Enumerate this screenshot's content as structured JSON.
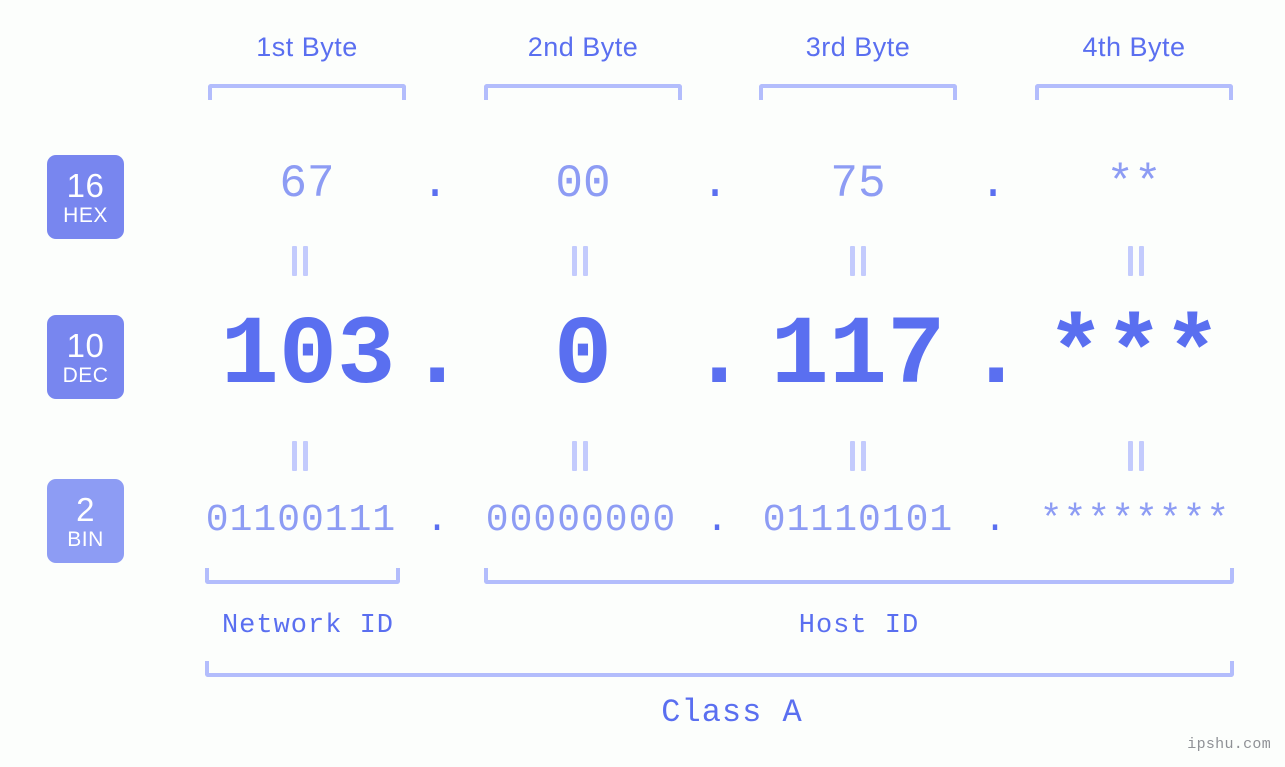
{
  "background_color": "#fcfefc",
  "accent_color": "#5a6ff0",
  "accent_light": "#8d9cf4",
  "bracket_color": "#b3bdfc",
  "byte_headers": [
    {
      "label": "1st Byte"
    },
    {
      "label": "2nd Byte"
    },
    {
      "label": "3rd Byte"
    },
    {
      "label": "4th Byte"
    }
  ],
  "bases": [
    {
      "number": "16",
      "name": "HEX",
      "badge_color": "#7886ef"
    },
    {
      "number": "10",
      "name": "DEC",
      "badge_color": "#7886ef"
    },
    {
      "number": "2",
      "name": "BIN",
      "badge_color": "#8d9cf4"
    }
  ],
  "separator": ".",
  "rows": {
    "hex": {
      "base_label": "HEX",
      "values": [
        "67",
        "00",
        "75",
        "**"
      ]
    },
    "dec": {
      "base_label": "DEC",
      "values": [
        "103",
        "0",
        "117",
        "***"
      ]
    },
    "bin": {
      "base_label": "BIN",
      "values": [
        "01100111",
        "00000000",
        "01110101",
        "********"
      ]
    }
  },
  "equals_marker": "||",
  "sections": [
    {
      "label": "Network ID"
    },
    {
      "label": "Host ID"
    }
  ],
  "class_label": "Class A",
  "watermark": "ipshu.com"
}
